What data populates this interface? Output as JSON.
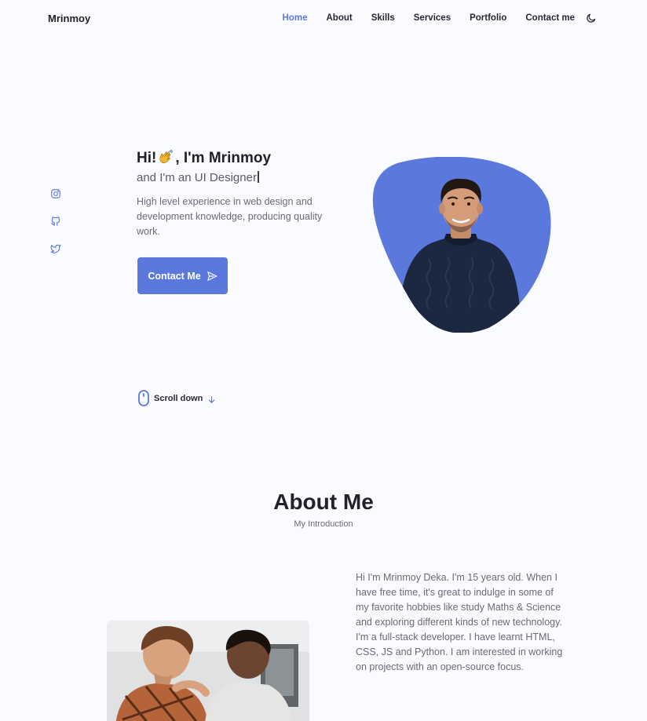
{
  "header": {
    "logo": "Mrinmoy",
    "nav": [
      {
        "label": "Home",
        "active": true
      },
      {
        "label": "About",
        "active": false
      },
      {
        "label": "Skills",
        "active": false
      },
      {
        "label": "Services",
        "active": false
      },
      {
        "label": "Portfolio",
        "active": false
      },
      {
        "label": "Contact me",
        "active": false
      }
    ],
    "theme_toggle_icon": "moon-icon"
  },
  "social": [
    "instagram-icon",
    "github-icon",
    "twitter-icon"
  ],
  "hero": {
    "greeting_pre": "Hi!",
    "greeting_post": ", I'm Mrinmoy",
    "wave_icon": "waving-hand-icon",
    "subtitle": "and I'm an UI Designer",
    "description": "High level experience in web design and development knowledge, producing quality work.",
    "cta_label": "Contact Me",
    "cta_icon": "send-icon"
  },
  "scroll": {
    "label": "Scroll down",
    "mouse_icon": "mouse-icon",
    "arrow_icon": "arrow-down-icon"
  },
  "about": {
    "title": "About Me",
    "subtitle": "My Introduction",
    "paragraph_1": "Hi I'm Mrinmoy Deka. I'm 15 years old. When I have free time, it's great to indulge in some of my favorite hobbies like study Maths & Science and exploring different kinds of new technology.",
    "paragraph_2": "I'm a full-stack developer. I have learnt HTML, CSS, JS and Python. I am interested in working on projects with an open-source focus."
  },
  "colors": {
    "accent": "#5b79dd",
    "background": "#fafbff",
    "text": "#232333",
    "muted": "#6a6a78"
  }
}
